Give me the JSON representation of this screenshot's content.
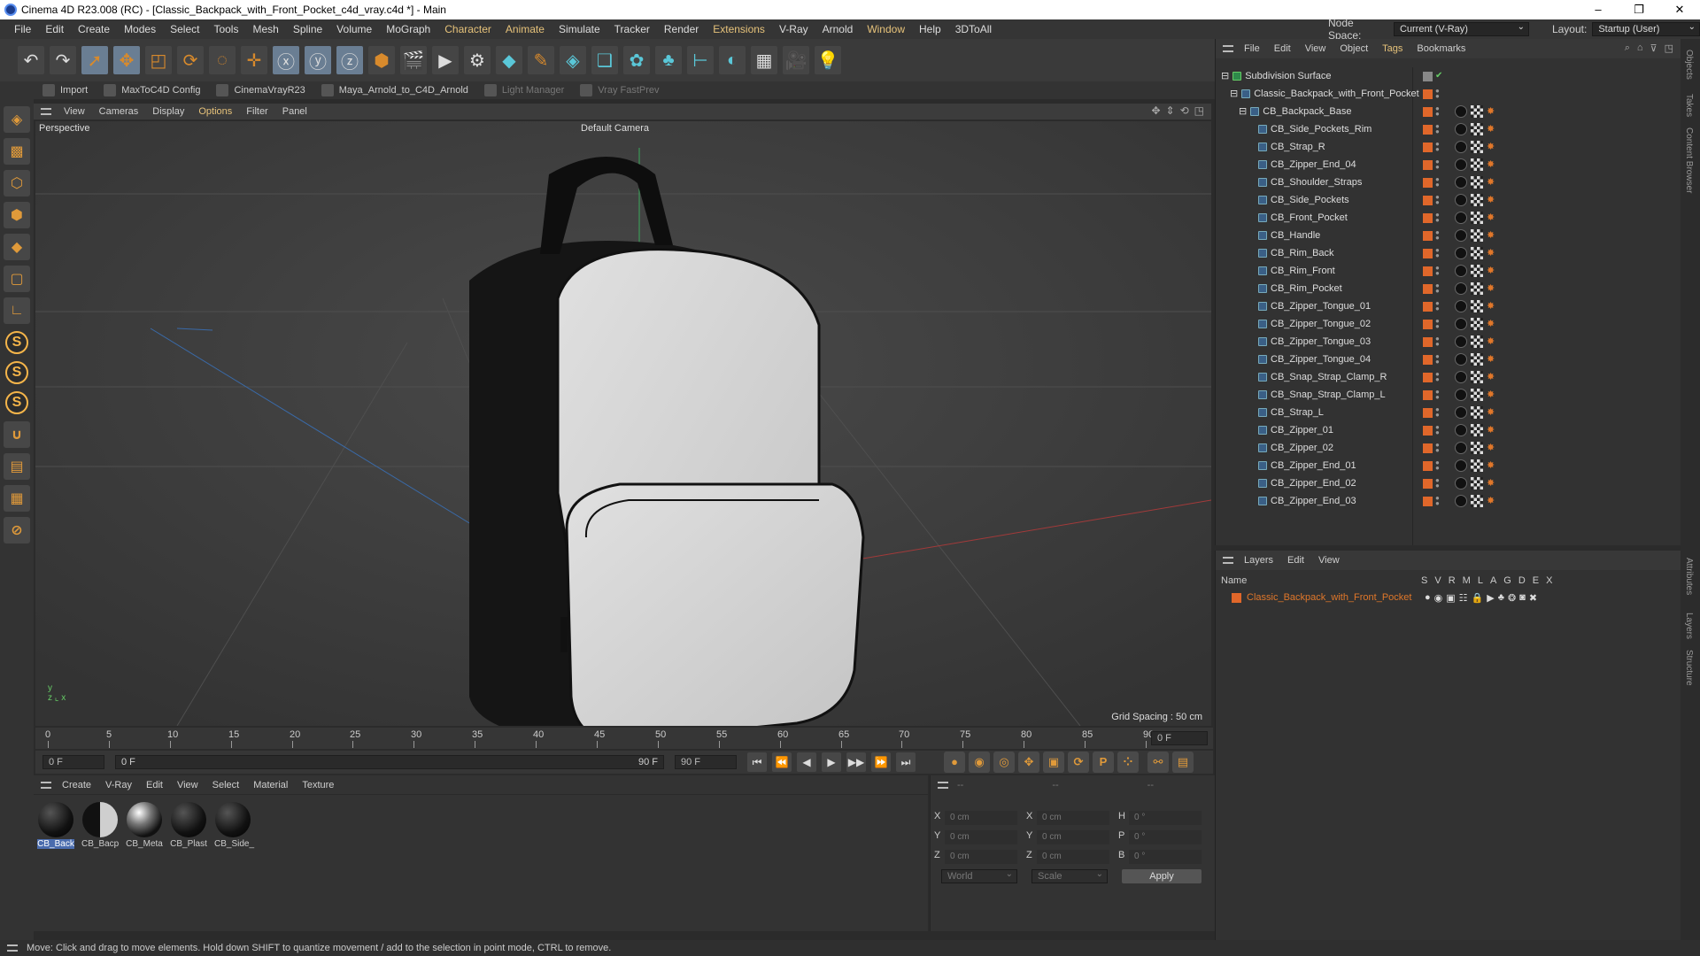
{
  "window": {
    "title": "Cinema 4D R23.008 (RC) - [Classic_Backpack_with_Front_Pocket_c4d_vray.c4d *] - Main",
    "min": "–",
    "max": "❐",
    "close": "✕"
  },
  "menu": [
    "File",
    "Edit",
    "Create",
    "Modes",
    "Select",
    "Tools",
    "Mesh",
    "Spline",
    "Volume",
    "MoGraph",
    "Character",
    "Animate",
    "Simulate",
    "Tracker",
    "Render",
    "Extensions",
    "V-Ray",
    "Arnold",
    "Window",
    "Help",
    "3DToAll"
  ],
  "nodespace": {
    "label": "Node Space:",
    "value": "Current (V-Ray)",
    "layout_label": "Layout:",
    "layout_value": "Startup (User)"
  },
  "plugins": [
    "Import",
    "MaxToC4D Config",
    "CinemaVrayR23",
    "Maya_Arnold_to_C4D_Arnold",
    "Light Manager",
    "Vray FastPrev"
  ],
  "viewport": {
    "menu": [
      "View",
      "Cameras",
      "Display",
      "Options",
      "Filter",
      "Panel"
    ],
    "label": "Perspective",
    "camera": "Default Camera",
    "grid": "Grid Spacing : 50 cm"
  },
  "timeline": {
    "ticks": [
      "0",
      "5",
      "10",
      "15",
      "20",
      "25",
      "30",
      "35",
      "40",
      "45",
      "50",
      "55",
      "60",
      "65",
      "70",
      "75",
      "80",
      "85",
      "90"
    ],
    "frame": "0 F"
  },
  "transport": {
    "start": "0 F",
    "range_start": "0 F",
    "range_end": "90 F",
    "end": "90 F"
  },
  "matmgr": {
    "menu": [
      "Create",
      "V-Ray",
      "Edit",
      "View",
      "Select",
      "Material",
      "Texture"
    ],
    "materials": [
      "CB_Back",
      "CB_Bacp",
      "CB_Meta",
      "CB_Plast",
      "CB_Side_"
    ]
  },
  "coords": {
    "head": [
      "--",
      "--",
      "--"
    ],
    "rows": [
      [
        "X",
        "0 cm",
        "X",
        "0 cm",
        "H",
        "0 °"
      ],
      [
        "Y",
        "0 cm",
        "Y",
        "0 cm",
        "P",
        "0 °"
      ],
      [
        "Z",
        "0 cm",
        "Z",
        "0 cm",
        "B",
        "0 °"
      ]
    ],
    "world": "World",
    "scale": "Scale",
    "apply": "Apply"
  },
  "status": "Move: Click and drag to move elements. Hold down SHIFT to quantize movement / add to the selection in point mode, CTRL to remove.",
  "objects": {
    "menu": [
      "File",
      "Edit",
      "View",
      "Object",
      "Tags",
      "Bookmarks"
    ],
    "root": "Subdivision Surface",
    "group": "Classic_Backpack_with_Front_Pocket",
    "base": "CB_Backpack_Base",
    "items": [
      "CB_Side_Pockets_Rim",
      "CB_Strap_R",
      "CB_Zipper_End_04",
      "CB_Shoulder_Straps",
      "CB_Side_Pockets",
      "CB_Front_Pocket",
      "CB_Handle",
      "CB_Rim_Back",
      "CB_Rim_Front",
      "CB_Rim_Pocket",
      "CB_Zipper_Tongue_01",
      "CB_Zipper_Tongue_02",
      "CB_Zipper_Tongue_03",
      "CB_Zipper_Tongue_04",
      "CB_Snap_Strap_Clamp_R",
      "CB_Snap_Strap_Clamp_L",
      "CB_Strap_L",
      "CB_Zipper_01",
      "CB_Zipper_02",
      "CB_Zipper_End_01",
      "CB_Zipper_End_02",
      "CB_Zipper_End_03"
    ]
  },
  "layers": {
    "menu": [
      "Layers",
      "Edit",
      "View"
    ],
    "name_col": "Name",
    "cols": [
      "S",
      "V",
      "R",
      "M",
      "L",
      "A",
      "G",
      "D",
      "E",
      "X"
    ],
    "row": "Classic_Backpack_with_Front_Pocket"
  },
  "side_tabs": [
    "Objects",
    "Takes",
    "Content Browser",
    "Attributes",
    "Layers",
    "Structure"
  ]
}
